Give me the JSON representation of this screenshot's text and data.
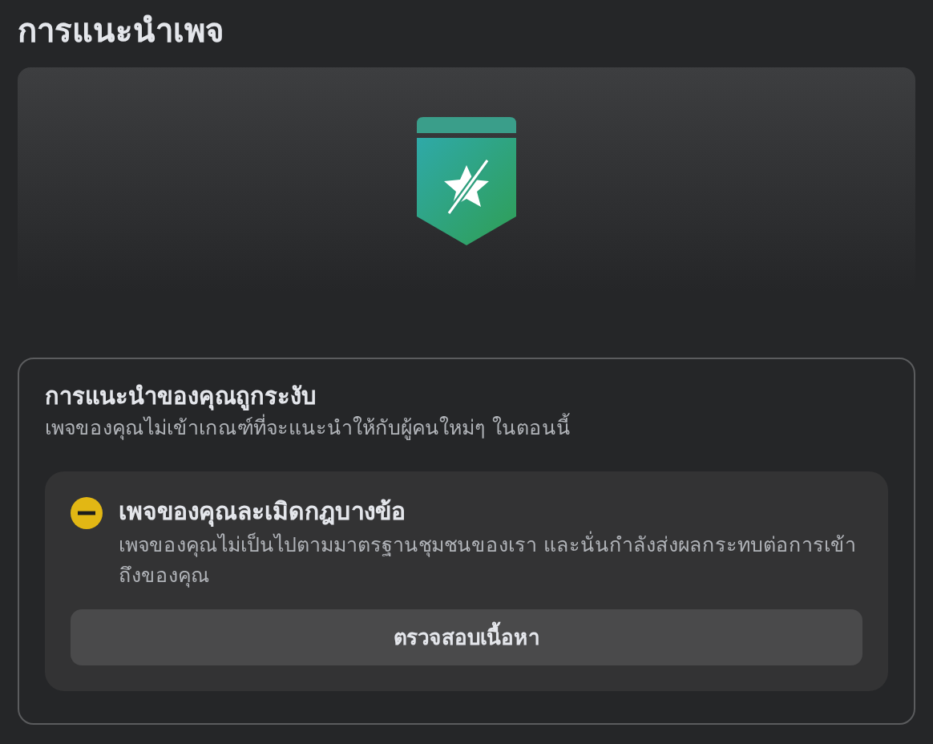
{
  "page": {
    "title": "การแนะนำเพจ"
  },
  "status_card": {
    "title": "การแนะนำของคุณถูกระงับ",
    "description": "เพจของคุณไม่เข้าเกณฑ์ที่จะแนะนำให้กับผู้คนใหม่ๆ ในตอนนี้",
    "issue": {
      "kind": "warning",
      "title": "เพจของคุณละเมิดกฎบางข้อ",
      "description": "เพจของคุณไม่เป็นไปตามมาตรฐานชุมชนของเรา และนั่นกำลังส่งผลกระทบต่อการเข้าถึงของคุณ",
      "button": "ตรวจสอบเนื้อหา"
    }
  }
}
